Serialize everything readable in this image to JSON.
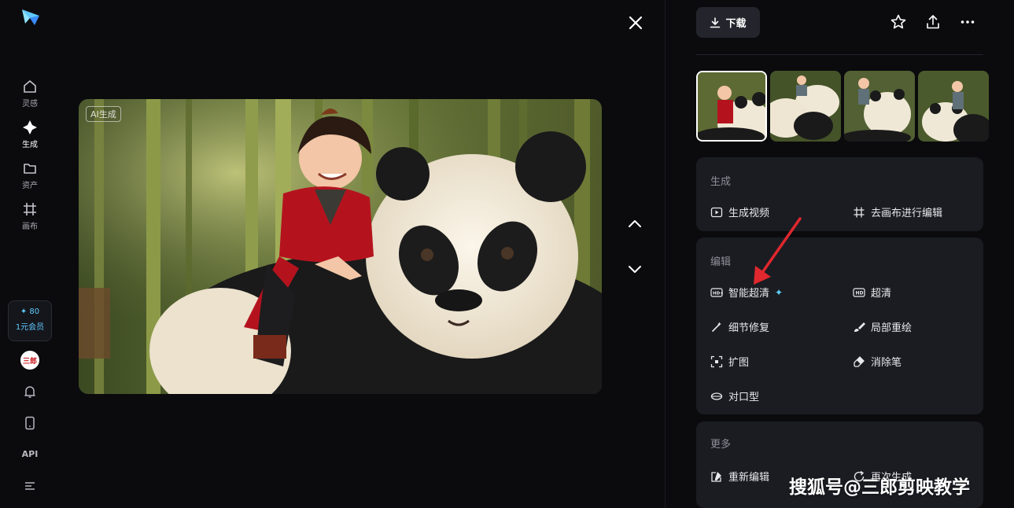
{
  "sidebar": {
    "items": [
      {
        "label": "灵感",
        "icon": "home-icon"
      },
      {
        "label": "生成",
        "icon": "sparkle-icon",
        "active": true
      },
      {
        "label": "资产",
        "icon": "folder-icon"
      },
      {
        "label": "画布",
        "icon": "canvas-icon"
      }
    ],
    "vip": {
      "points": "✦ 80",
      "label": "1元会员"
    },
    "avatar_text": "三郎",
    "api_label": "API"
  },
  "viewer": {
    "ai_tag": "AI生成"
  },
  "panel": {
    "download_label": "下载",
    "generate": {
      "title": "生成",
      "actions": [
        "生成视频",
        "去画布进行编辑"
      ]
    },
    "edit": {
      "title": "编辑",
      "actions": [
        "智能超清",
        "超清",
        "细节修复",
        "局部重绘",
        "扩图",
        "消除笔",
        "对口型"
      ]
    },
    "more": {
      "title": "更多",
      "actions": [
        "重新编辑",
        "再次生成"
      ]
    }
  },
  "watermark": "搜狐号@三郎剪映教学",
  "colors": {
    "accent": "#5fd3ff",
    "card": "#1b1c22",
    "bg": "#0b0b0e",
    "arrow": "#e0282e"
  }
}
